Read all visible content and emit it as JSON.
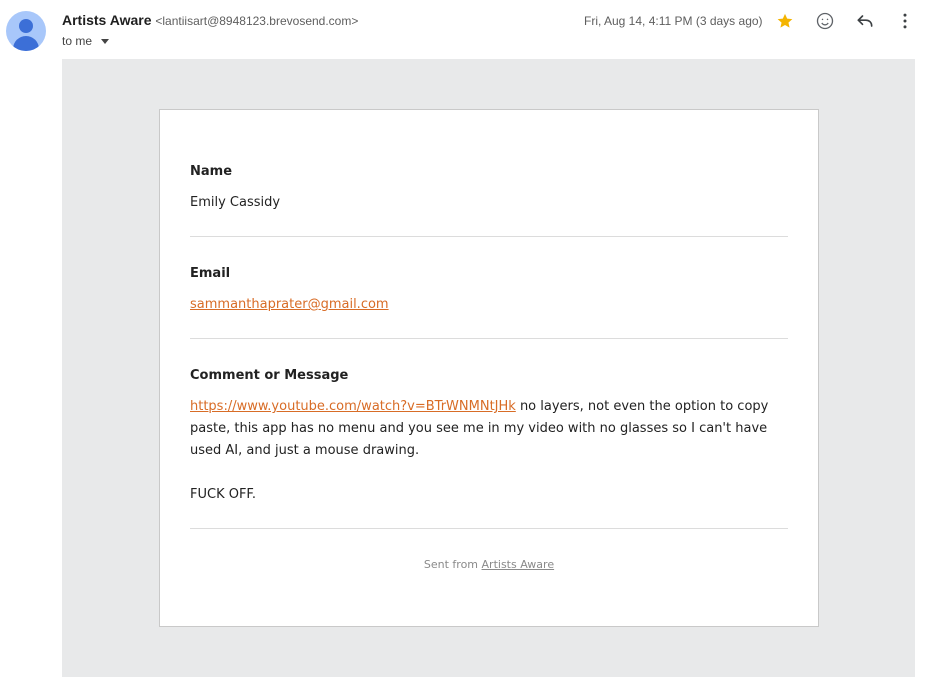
{
  "header": {
    "sender_name": "Artists Aware",
    "sender_email": "<lantiisart@8948123.brevosend.com>",
    "recipient": "to me",
    "date": "Fri, Aug 14, 4:11 PM (3 days ago)",
    "starred": true,
    "star_color": "#f4b400",
    "icons": [
      "star-icon",
      "emoji-icon",
      "reply-icon",
      "more-vert-icon"
    ]
  },
  "form": {
    "name_label": "Name",
    "name_value": "Emily Cassidy",
    "email_label": "Email",
    "email_value": "sammanthaprater@gmail.com",
    "message_label": "Comment or Message",
    "message_link": "https://www.youtube.com/watch?v=BTrWNMNtJHk",
    "message_text": " no layers, not even the option to copy paste, this app has no menu and you see me in my video with no glasses so I can't have used AI, and just a mouse drawing.",
    "message_text_2": "FUCK OFF."
  },
  "footer": {
    "prefix": "Sent from ",
    "link": "Artists Aware"
  },
  "colors": {
    "link": "#d86c26",
    "frame_bg": "#e8e9ea",
    "avatar_bg": "#a8c7fa",
    "avatar_fg": "#3c6fd7"
  }
}
